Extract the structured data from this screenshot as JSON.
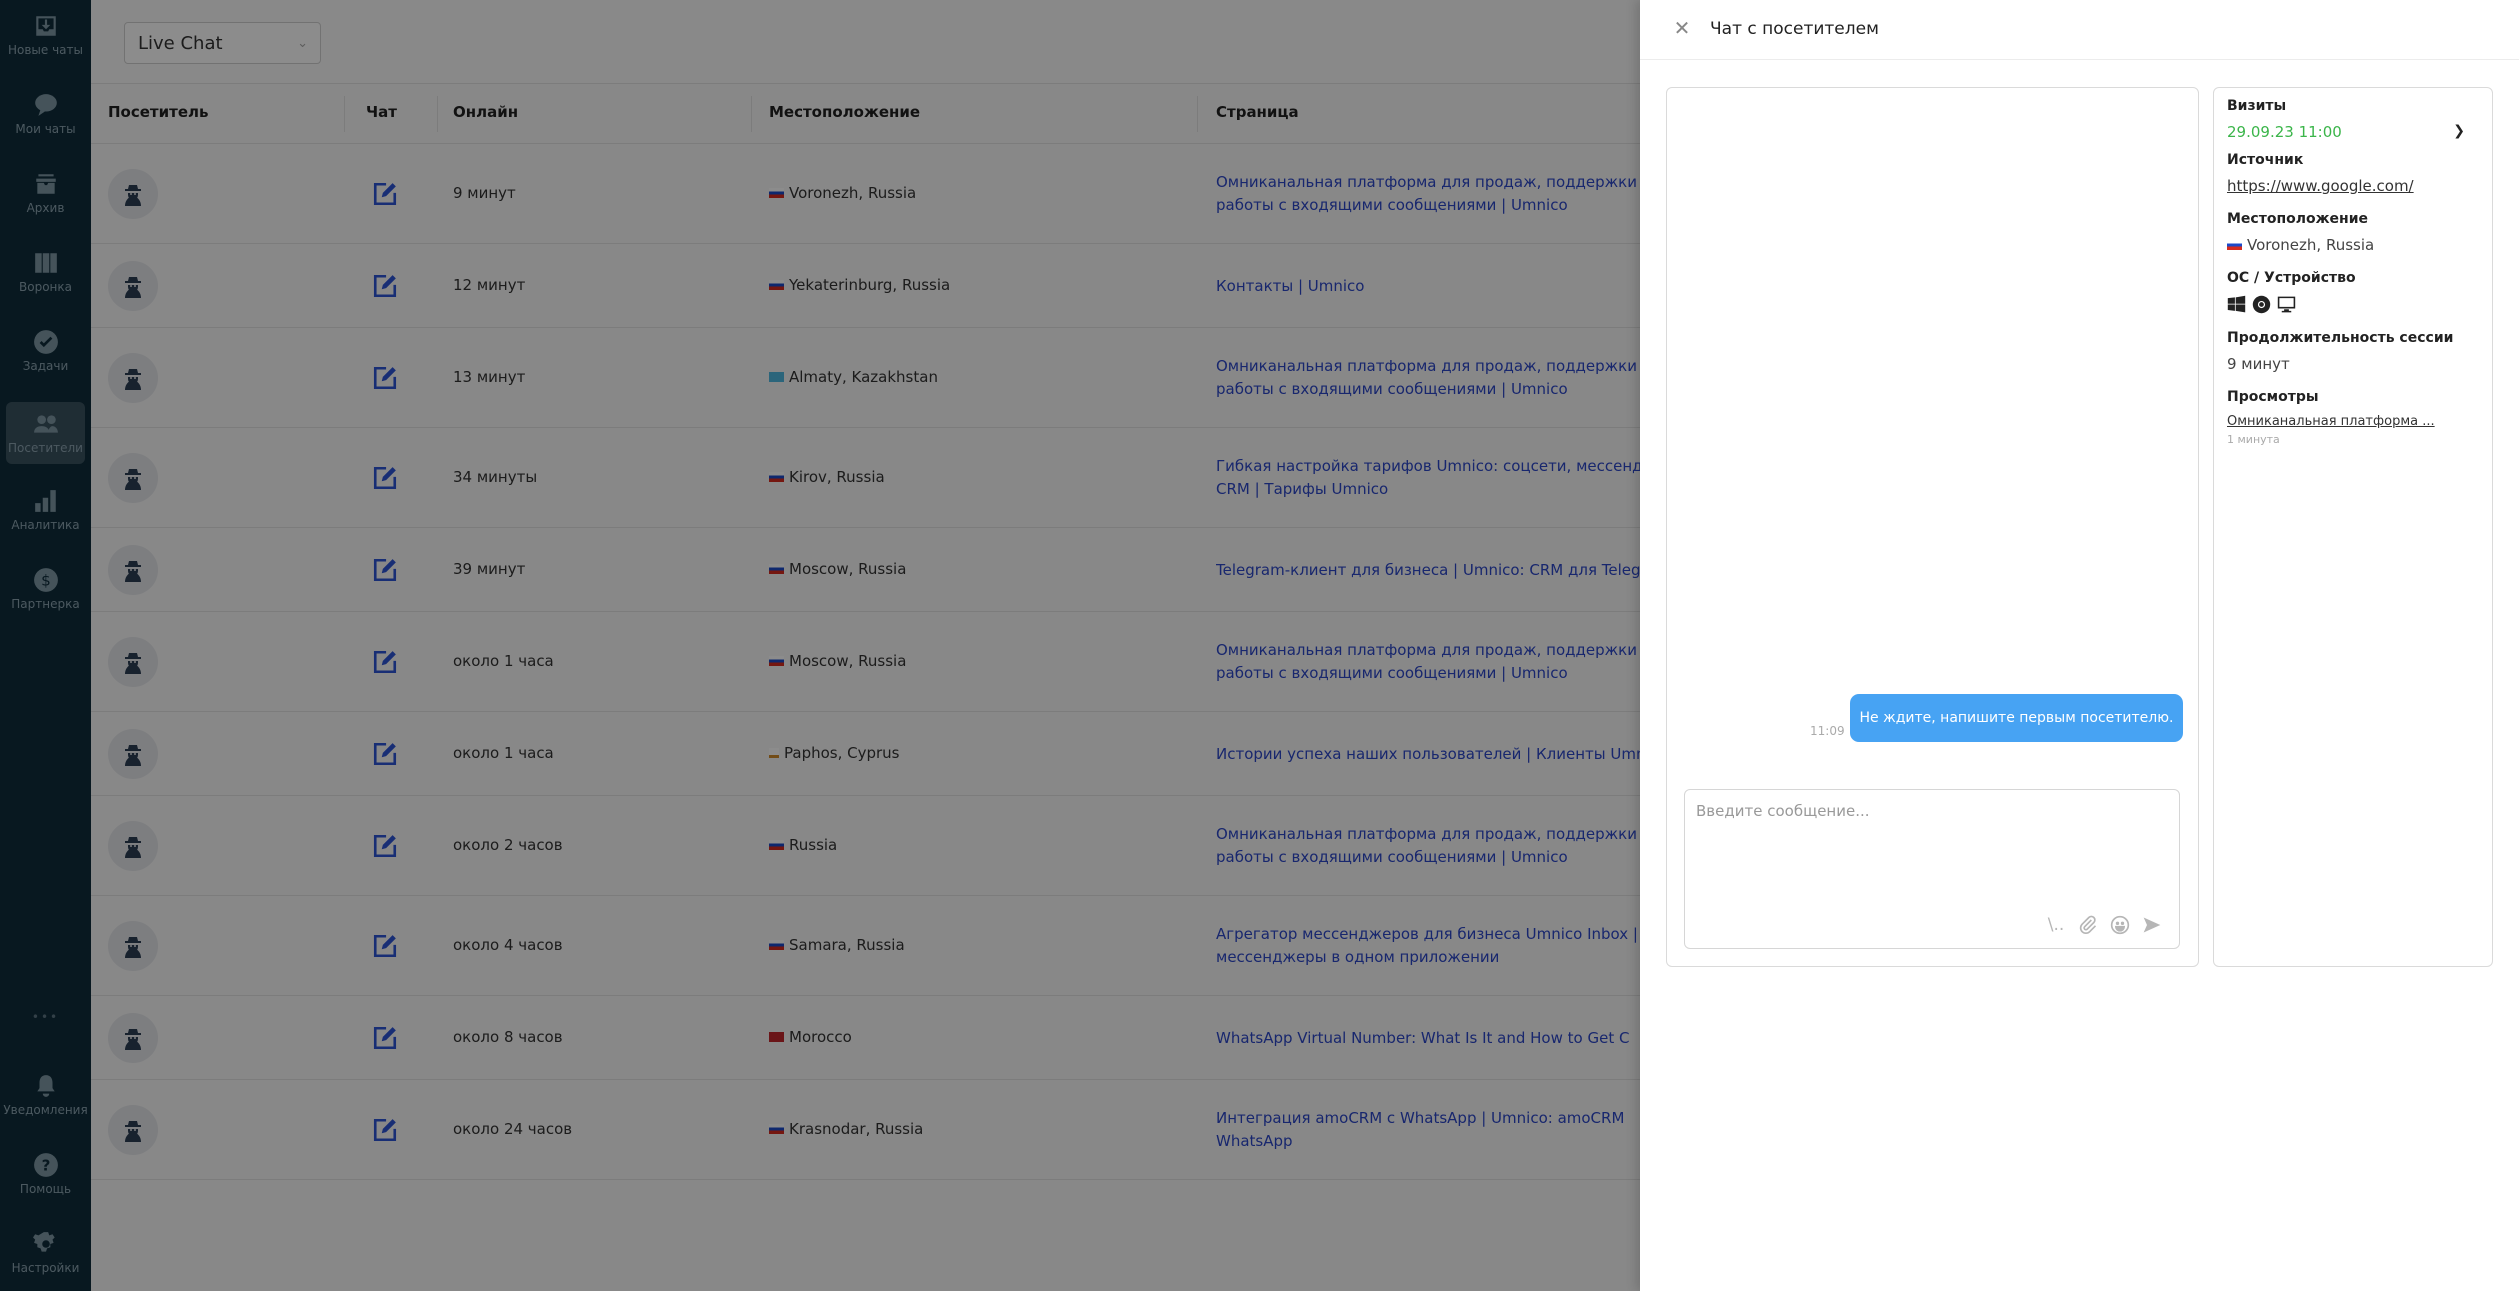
{
  "sidebar": {
    "items": [
      {
        "label": "Новые чаты",
        "icon": "inbox-download-icon"
      },
      {
        "label": "Мои чаты",
        "icon": "chat-bubble-icon"
      },
      {
        "label": "Архив",
        "icon": "archive-box-icon"
      },
      {
        "label": "Воронка",
        "icon": "funnel-columns-icon"
      },
      {
        "label": "Задачи",
        "icon": "check-circle-icon"
      },
      {
        "label": "Посетители",
        "icon": "users-icon",
        "active": true
      },
      {
        "label": "Аналитика",
        "icon": "bar-chart-icon"
      },
      {
        "label": "Партнерка",
        "icon": "dollar-circle-icon"
      }
    ],
    "more": "•••",
    "bottom_items": [
      {
        "label": "Уведомления",
        "icon": "bell-icon"
      },
      {
        "label": "Помощь",
        "icon": "question-circle-icon"
      },
      {
        "label": "Настройки",
        "icon": "gear-icon"
      }
    ]
  },
  "topbar": {
    "channel_select": "Live Chat"
  },
  "table": {
    "columns": [
      "Посетитель",
      "Чат",
      "Онлайн",
      "Местоположение",
      "Страница"
    ],
    "rows": [
      {
        "online": "9 минут",
        "flag": "ru",
        "location": "Voronezh, Russia",
        "page": [
          "Омниканальная платформа для продаж, поддержки к",
          "работы с входящими сообщениями | Umnico"
        ]
      },
      {
        "online": "12 минут",
        "flag": "ru",
        "location": "Yekaterinburg, Russia",
        "page": [
          "Контакты | Umnico"
        ]
      },
      {
        "online": "13 минут",
        "flag": "kz",
        "location": "Almaty, Kazakhstan",
        "page": [
          "Омниканальная платформа для продаж, поддержки к",
          "работы с входящими сообщениями | Umnico"
        ]
      },
      {
        "online": "34 минуты",
        "flag": "ru",
        "location": "Kirov, Russia",
        "page": [
          "Гибкая настройка тарифов Umnico: соцсети, мессенд",
          "CRM | Тарифы Umnico"
        ]
      },
      {
        "online": "39 минут",
        "flag": "ru",
        "location": "Moscow, Russia",
        "page": [
          "Telegram-клиент для бизнеса | Umnico: CRM для Teleg"
        ]
      },
      {
        "online": "около 1 часа",
        "flag": "ru",
        "location": "Moscow, Russia",
        "page": [
          "Омниканальная платформа для продаж, поддержки к",
          "работы с входящими сообщениями | Umnico"
        ]
      },
      {
        "online": "около 1 часа",
        "flag": "cy",
        "location": "Paphos, Cyprus",
        "page": [
          "Истории успеха наших пользователей | Клиенты Umn"
        ]
      },
      {
        "online": "около 2 часов",
        "flag": "ru",
        "location": "Russia",
        "page": [
          "Омниканальная платформа для продаж, поддержки к",
          "работы с входящими сообщениями | Umnico"
        ]
      },
      {
        "online": "около 4 часов",
        "flag": "ru",
        "location": "Samara, Russia",
        "page": [
          "Агрегатор мессенджеров для бизнеса Umnico Inbox |",
          "мессенджеры в одном приложении"
        ]
      },
      {
        "online": "около 8 часов",
        "flag": "ma",
        "location": "Morocco",
        "page": [
          "WhatsApp Virtual Number: What Is It and How to Get C"
        ]
      },
      {
        "online": "около 24 часов",
        "flag": "ru",
        "location": "Krasnodar, Russia",
        "page": [
          "Интеграция amoCRM с WhatsApp | Umnico: amoCRM",
          "WhatsApp"
        ]
      }
    ]
  },
  "modal": {
    "title": "Чат с посетителем",
    "messages": [
      {
        "time": "11:09",
        "text": "Не ждите, напишите первым посетителю."
      }
    ],
    "composer": {
      "placeholder": "Введите сообщение...",
      "value": "",
      "quick_replies_glyph": "\\.."
    },
    "info": {
      "visits_label": "Визиты",
      "visit_date": "29.09.23 11:00",
      "source_label": "Источник",
      "source_url": "https://www.google.com/",
      "location_label": "Местоположение",
      "location": "Voronezh, Russia",
      "os_label": "ОС / Устройство",
      "os_icons": [
        "windows-icon",
        "chrome-icon",
        "desktop-icon"
      ],
      "duration_label": "Продолжительность сессии",
      "duration": "9 минут",
      "views_label": "Просмотры",
      "views": [
        {
          "title": "Омниканальная платформа ...",
          "time": "1 минута"
        }
      ]
    },
    "colors": {
      "bubble": "#47a3f3",
      "visit_date": "#3bb54a",
      "page_link": "#2d47c8"
    }
  }
}
